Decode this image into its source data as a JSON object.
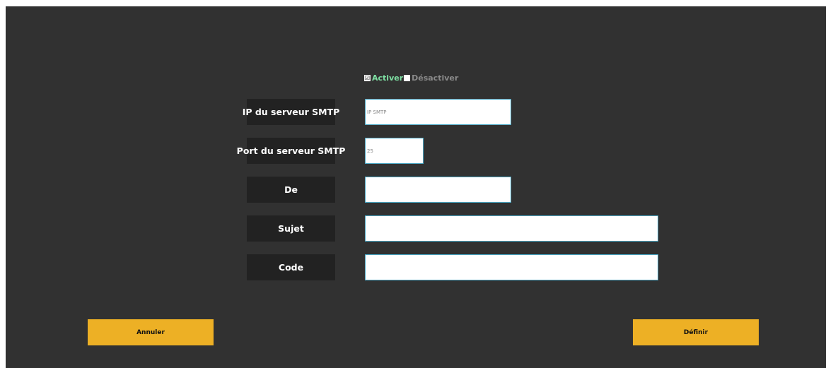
{
  "toggle": {
    "enable_label": "Activer",
    "disable_label": "Désactiver",
    "selected": "Activer",
    "checkmark": "☑"
  },
  "fields": {
    "smtp_ip": {
      "label": "IP du serveur SMTP",
      "placeholder": "IP SMTP",
      "value": ""
    },
    "smtp_port": {
      "label": "Port du serveur SMTP",
      "placeholder": "",
      "value": "25"
    },
    "from": {
      "label": "De",
      "placeholder": "",
      "value": ""
    },
    "subject": {
      "label": "Sujet",
      "placeholder": "",
      "value": ""
    },
    "code": {
      "label": "Code",
      "placeholder": "",
      "value": ""
    }
  },
  "buttons": {
    "cancel_label": "Annuler",
    "define_label": "Définir"
  },
  "colors": {
    "panel_bg": "#313131",
    "label_bg": "#222222",
    "accent_green": "#7ee0a3",
    "button_yellow": "#edb025",
    "input_border": "#4aa7c4"
  }
}
